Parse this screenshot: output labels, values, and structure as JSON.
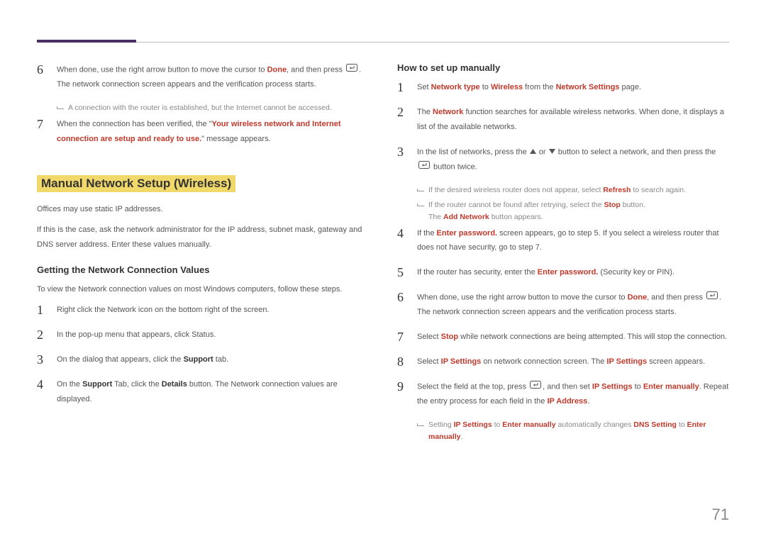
{
  "pageNumber": "71",
  "left": {
    "steps_a": [
      {
        "n": "6",
        "parts": [
          {
            "t": "When done, use the right arrow button to move the cursor to "
          },
          {
            "t": "Done",
            "cls": "accent"
          },
          {
            "t": ", and then press "
          },
          {
            "icon": "enter"
          },
          {
            "t": ". The network connection screen appears and the verification process starts."
          }
        ],
        "note": [
          {
            "t": "A connection with the router is established, but the Internet cannot be accessed."
          }
        ]
      },
      {
        "n": "7",
        "parts": [
          {
            "t": "When the connection has been verified, the \""
          },
          {
            "t": "Your wireless network and Internet connection are setup and ready to use.",
            "cls": "accent"
          },
          {
            "t": "\" message appears."
          }
        ]
      }
    ],
    "sectionTitle": "Manual Network Setup (Wireless)",
    "para1": "Offices may use static IP addresses.",
    "para2": "If this is the case, ask the network administrator for the IP address, subnet mask, gateway and DNS server address. Enter these values manually.",
    "subTitle": "Getting the Network Connection Values",
    "para3": "To view the Network connection values on most Windows computers, follow these steps.",
    "steps_b": [
      {
        "n": "1",
        "parts": [
          {
            "t": "Right click the Network icon on the bottom right of the screen."
          }
        ]
      },
      {
        "n": "2",
        "parts": [
          {
            "t": "In the pop-up menu that appears, click Status."
          }
        ]
      },
      {
        "n": "3",
        "parts": [
          {
            "t": "On the dialog that appears, click the "
          },
          {
            "t": "Support",
            "cls": "bold"
          },
          {
            "t": " tab."
          }
        ]
      },
      {
        "n": "4",
        "parts": [
          {
            "t": "On the "
          },
          {
            "t": "Support",
            "cls": "bold"
          },
          {
            "t": " Tab, click the "
          },
          {
            "t": "Details",
            "cls": "bold"
          },
          {
            "t": " button. The Network connection values are displayed."
          }
        ]
      }
    ]
  },
  "right": {
    "subTitle": "How to set up manually",
    "steps": [
      {
        "n": "1",
        "parts": [
          {
            "t": "Set "
          },
          {
            "t": "Network type",
            "cls": "accent"
          },
          {
            "t": " to "
          },
          {
            "t": "Wireless",
            "cls": "accent"
          },
          {
            "t": " from the "
          },
          {
            "t": "Network Settings",
            "cls": "accent"
          },
          {
            "t": " page."
          }
        ]
      },
      {
        "n": "2",
        "parts": [
          {
            "t": "The "
          },
          {
            "t": "Network",
            "cls": "accent"
          },
          {
            "t": " function searches for available wireless networks. When done, it displays a list of the available networks."
          }
        ]
      },
      {
        "n": "3",
        "parts": [
          {
            "t": "In the list of networks, press the "
          },
          {
            "icon": "up"
          },
          {
            "t": " or "
          },
          {
            "icon": "down"
          },
          {
            "t": " button to select a network, and then press the "
          },
          {
            "icon": "enter"
          },
          {
            "t": " button twice."
          }
        ],
        "notes": [
          {
            "parts": [
              {
                "t": "If the desired wireless router does not appear, select "
              },
              {
                "t": "Refresh",
                "cls": "accent"
              },
              {
                "t": " to search again."
              }
            ]
          },
          {
            "parts": [
              {
                "t": "If the router cannot be found after retrying, select the "
              },
              {
                "t": "Stop",
                "cls": "accent"
              },
              {
                "t": " button."
              }
            ],
            "extra": [
              {
                "t": "The "
              },
              {
                "t": "Add Network",
                "cls": "accent"
              },
              {
                "t": " button appears."
              }
            ]
          }
        ]
      },
      {
        "n": "4",
        "parts": [
          {
            "t": "If the "
          },
          {
            "t": "Enter password.",
            "cls": "accent"
          },
          {
            "t": " screen appears, go to step 5. If you select a wireless router that does not have security, go to step 7."
          }
        ]
      },
      {
        "n": "5",
        "parts": [
          {
            "t": "If the router has security, enter the "
          },
          {
            "t": "Enter password.",
            "cls": "accent"
          },
          {
            "t": " (Security key or PIN)."
          }
        ]
      },
      {
        "n": "6",
        "parts": [
          {
            "t": "When done, use the right arrow button to move the cursor to "
          },
          {
            "t": "Done",
            "cls": "accent"
          },
          {
            "t": ", and then press "
          },
          {
            "icon": "enter"
          },
          {
            "t": ". The network connection screen appears and the verification process starts."
          }
        ]
      },
      {
        "n": "7",
        "parts": [
          {
            "t": "Select "
          },
          {
            "t": "Stop",
            "cls": "accent"
          },
          {
            "t": " while network connections are being attempted. This will stop the connection."
          }
        ]
      },
      {
        "n": "8",
        "parts": [
          {
            "t": "Select "
          },
          {
            "t": "IP Settings",
            "cls": "accent"
          },
          {
            "t": " on network connection screen. The "
          },
          {
            "t": "IP Settings",
            "cls": "accent"
          },
          {
            "t": " screen appears."
          }
        ]
      },
      {
        "n": "9",
        "parts": [
          {
            "t": "Select the field at the top, press "
          },
          {
            "icon": "enter"
          },
          {
            "t": ", and then set "
          },
          {
            "t": "IP Settings",
            "cls": "accent"
          },
          {
            "t": " to "
          },
          {
            "t": "Enter manually",
            "cls": "accent"
          },
          {
            "t": ". Repeat the entry process for each field in the "
          },
          {
            "t": "IP Address",
            "cls": "accent"
          },
          {
            "t": "."
          }
        ],
        "notes": [
          {
            "parts": [
              {
                "t": "Setting "
              },
              {
                "t": "IP Settings",
                "cls": "accent"
              },
              {
                "t": " to "
              },
              {
                "t": "Enter manually",
                "cls": "accent"
              },
              {
                "t": " automatically changes "
              },
              {
                "t": "DNS Setting",
                "cls": "accent"
              },
              {
                "t": " to "
              },
              {
                "t": "Enter manually",
                "cls": "accent"
              },
              {
                "t": "."
              }
            ]
          }
        ]
      }
    ]
  }
}
